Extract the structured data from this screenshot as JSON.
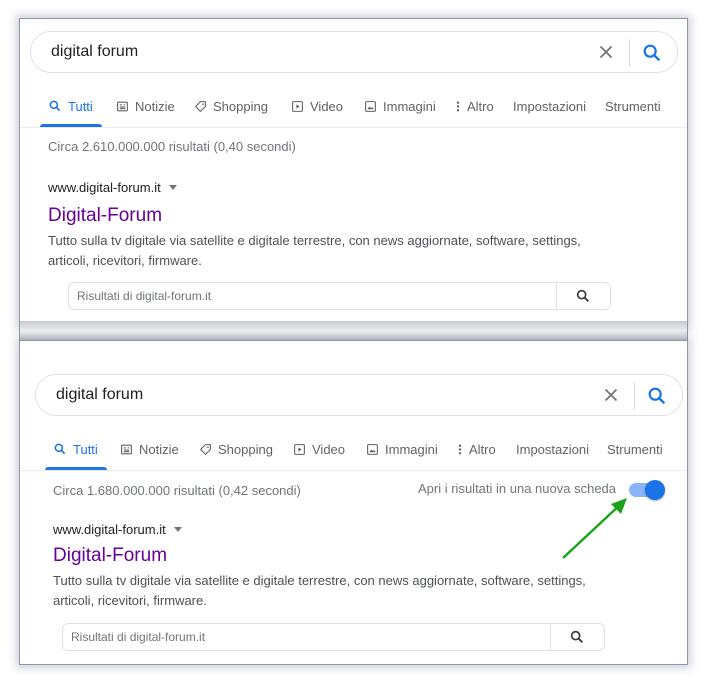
{
  "panel1": {
    "search_query": "digital forum",
    "tabs": [
      {
        "label": "Tutti",
        "icon": "search-icon",
        "active": true
      },
      {
        "label": "Notizie",
        "icon": "news-icon"
      },
      {
        "label": "Shopping",
        "icon": "tag-icon"
      },
      {
        "label": "Video",
        "icon": "play-icon"
      },
      {
        "label": "Immagini",
        "icon": "image-icon"
      },
      {
        "label": "Altro",
        "icon": "more-vertical-icon"
      },
      {
        "label": "Impostazioni"
      },
      {
        "label": "Strumenti"
      }
    ],
    "stats": "Circa 2.610.000.000 risultati (0,40 secondi)",
    "result": {
      "cite": "www.digital-forum.it",
      "title": "Digital-Forum",
      "snippet_line1": "Tutto sulla tv digitale via satellite e digitale terrestre, con news aggiornate, software, settings,",
      "snippet_line2": "articoli, ricevitori, firmware.",
      "site_search_placeholder": "Risultati di digital-forum.it"
    }
  },
  "panel2": {
    "search_query": "digital forum",
    "tabs": [
      {
        "label": "Tutti",
        "icon": "search-icon",
        "active": true
      },
      {
        "label": "Notizie",
        "icon": "news-icon"
      },
      {
        "label": "Shopping",
        "icon": "tag-icon"
      },
      {
        "label": "Video",
        "icon": "play-icon"
      },
      {
        "label": "Immagini",
        "icon": "image-icon"
      },
      {
        "label": "Altro",
        "icon": "more-vertical-icon"
      },
      {
        "label": "Impostazioni"
      },
      {
        "label": "Strumenti"
      }
    ],
    "stats": "Circa 1.680.000.000 risultati (0,42 secondi)",
    "new_tab_label": "Apri i risultati in una nuova scheda",
    "new_tab_toggle_on": true,
    "result": {
      "cite": "www.digital-forum.it",
      "title": "Digital-Forum",
      "snippet_line1": "Tutto sulla tv digitale via satellite e digitale terrestre, con news aggiornate, software, settings,",
      "snippet_line2": "articoli, ricevitori, firmware.",
      "site_search_placeholder": "Risultati di digital-forum.it"
    }
  },
  "colors": {
    "accent": "#1a73e8",
    "visited_link": "#660099",
    "annotation_arrow": "#1aa31a"
  }
}
